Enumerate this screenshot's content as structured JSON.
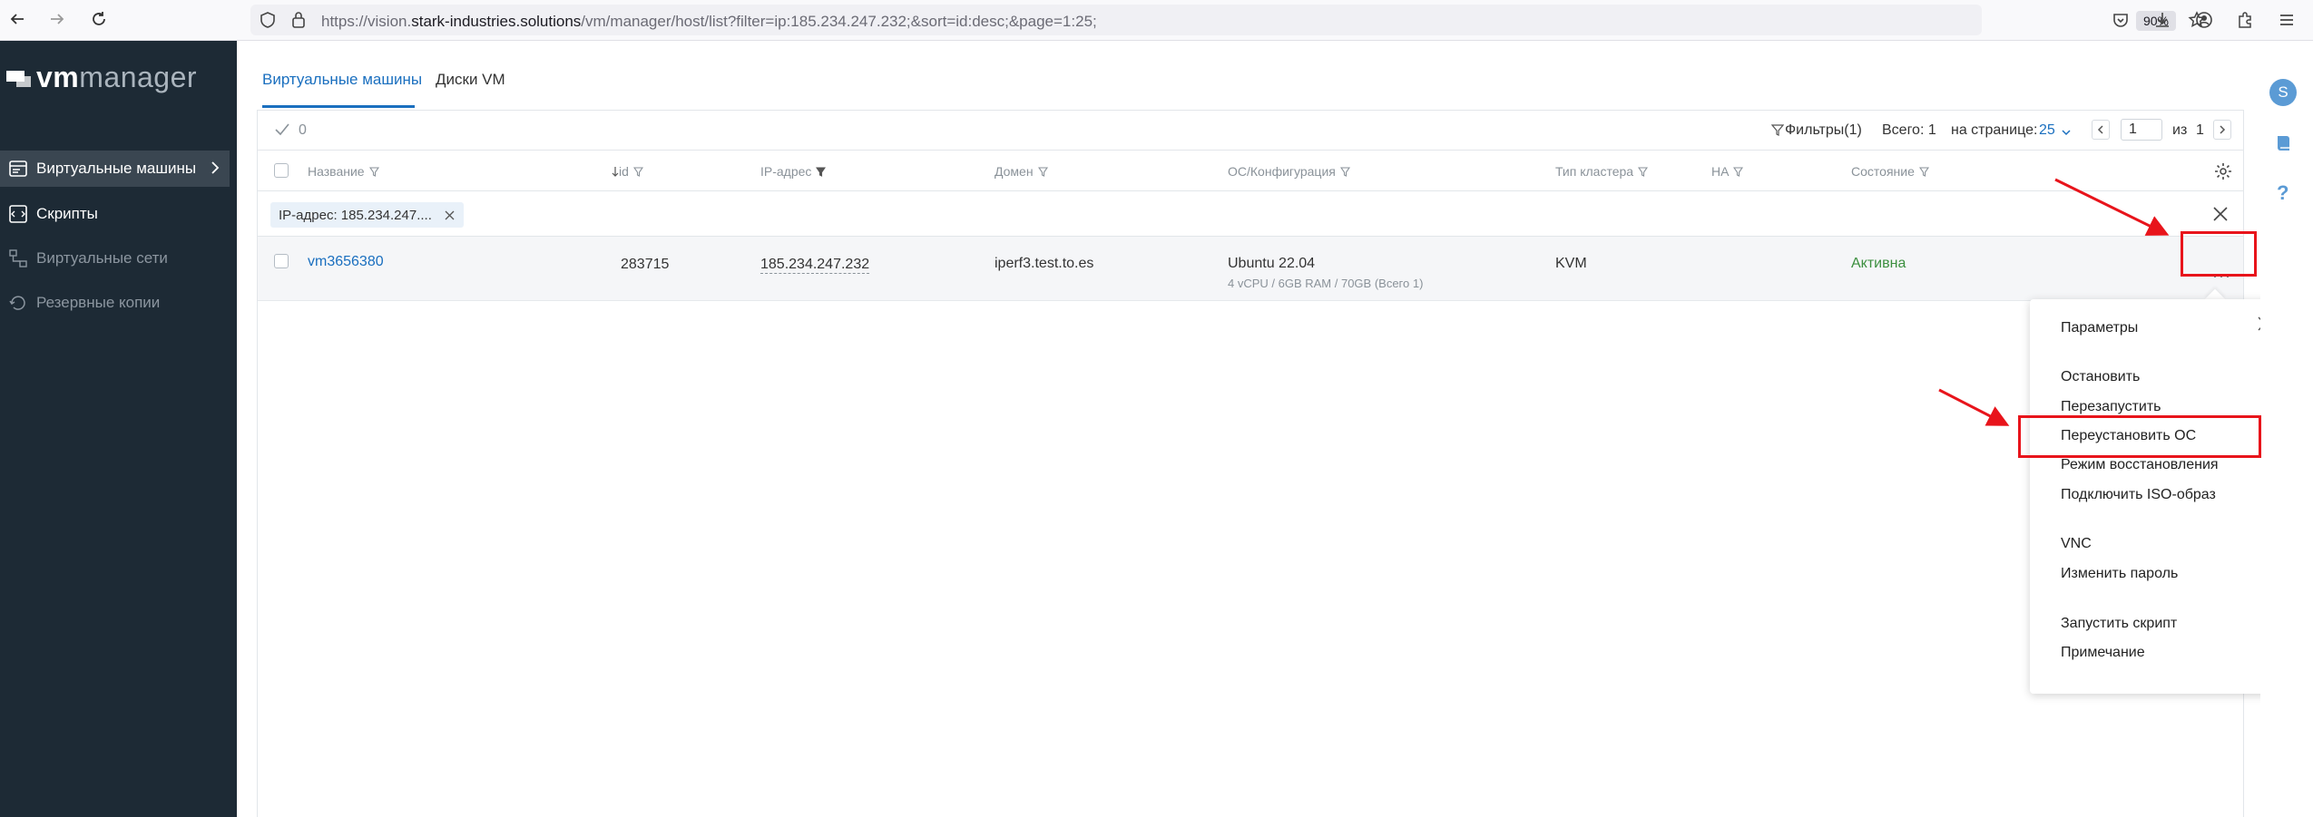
{
  "browser": {
    "url_prefix": "https://vision.",
    "url_domain": "stark-industries.solutions",
    "url_path": "/vm/manager/host/list?filter=ip:185.234.247.232;&sort=id:desc;&page=1:25;",
    "zoom": "90%"
  },
  "sidebar": {
    "logo_bold": "vm",
    "logo_light": "manager",
    "items": [
      {
        "label": "Виртуальные машины",
        "icon": "vm-list-icon"
      },
      {
        "label": "Скрипты",
        "icon": "script-icon"
      },
      {
        "label": "Виртуальные сети",
        "icon": "network-icon"
      },
      {
        "label": "Резервные копии",
        "icon": "backup-icon"
      }
    ]
  },
  "tabs": [
    "Виртуальные машины",
    "Диски VM"
  ],
  "toolbar": {
    "selected_count": "0",
    "filters_label": "Фильтры(1)",
    "total_label": "Всего: 1",
    "per_page_label": "на странице:",
    "per_page_value": "25",
    "page_value": "1",
    "of_label": "из",
    "of_value": "1"
  },
  "table": {
    "headers": [
      "Название",
      "id",
      "IP-адрес",
      "Домен",
      "ОС/Конфигурация",
      "Тип кластера",
      "HA",
      "Состояние"
    ],
    "filter_chip": "IP-адрес: 185.234.247....",
    "row": {
      "name": "vm3656380",
      "id": "283715",
      "ip": "185.234.247.232",
      "domain": "iperf3.test.to.es",
      "os": "Ubuntu 22.04",
      "config": "4 vCPU / 6GB RAM / 70GB (Всего 1)",
      "cluster": "KVM",
      "ha": "",
      "state": "Активна",
      "state_color": "#3b8f3e"
    }
  },
  "menu": {
    "items": [
      "Параметры",
      "Остановить",
      "Перезапустить",
      "Переустановить ОС",
      "Режим восстановления",
      "Подключить ISO-образ",
      "VNC",
      "Изменить пароль",
      "Запустить скрипт",
      "Примечание"
    ]
  },
  "user": {
    "avatar_letter": "S"
  },
  "colors": {
    "accent": "#1a6fbf",
    "sidebar_bg": "#1d2a35",
    "annotation_red": "#e8141b"
  }
}
